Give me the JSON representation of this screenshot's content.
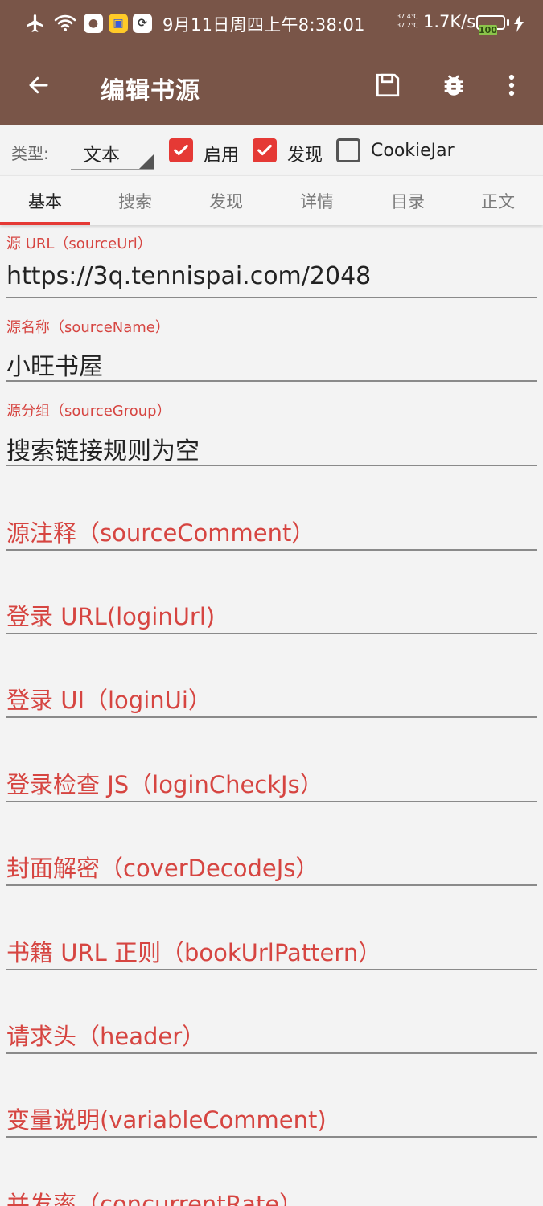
{
  "status_bar": {
    "time": "9月11日周四上午8:38:01",
    "temp_top": "37.4℃",
    "temp_bottom": "37.2℃",
    "net_speed": "1.7K/s",
    "battery": "100",
    "battery_level_percent": 100,
    "icons": [
      "airplane-icon",
      "wifi-icon",
      "qq-icon",
      "app-icon",
      "app-icon",
      "charging-icon"
    ]
  },
  "appbar": {
    "title": "编辑书源",
    "icons": [
      "back-arrow-icon",
      "save-icon",
      "bug-icon",
      "more-vert-icon"
    ]
  },
  "type_row": {
    "label": "类型:",
    "selected": "文本",
    "checkboxes": [
      {
        "label": "启用",
        "checked": true
      },
      {
        "label": "发现",
        "checked": true
      },
      {
        "label": "CookieJar",
        "checked": false
      }
    ]
  },
  "tabs": [
    "基本",
    "搜索",
    "发现",
    "详情",
    "目录",
    "正文"
  ],
  "active_tab": "基本",
  "accent_color": "#e53935",
  "appbar_color": "#795548",
  "fields": [
    {
      "label": "源 URL（sourceUrl）",
      "value": "https://3q.tennispai.com/2048"
    },
    {
      "label": "源名称（sourceName）",
      "value": "小旺书屋"
    },
    {
      "label": "源分组（sourceGroup）",
      "value": "搜索链接规则为空"
    },
    {
      "hint": "源注释（sourceComment）"
    },
    {
      "hint": "登录 URL(loginUrl)"
    },
    {
      "hint": "登录 UI（loginUi）"
    },
    {
      "hint": "登录检查 JS（loginCheckJs）"
    },
    {
      "hint": "封面解密（coverDecodeJs）"
    },
    {
      "hint": "书籍 URL 正则（bookUrlPattern）"
    },
    {
      "hint": "请求头（header）"
    },
    {
      "hint": "变量说明(variableComment)"
    },
    {
      "hint": "并发率（concurrentRate）"
    }
  ]
}
